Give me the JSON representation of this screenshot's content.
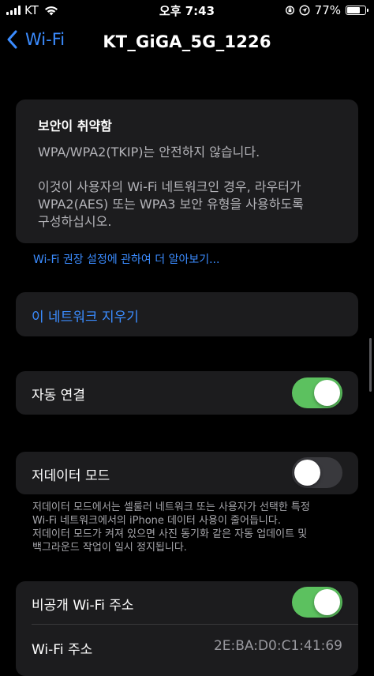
{
  "status_bar": {
    "carrier": "KT",
    "time": "오후 7:43",
    "battery_text": "77%",
    "battery_level": 0.77
  },
  "nav": {
    "back_label": "Wi-Fi",
    "title": "KT_GiGA_5G_1226"
  },
  "warning": {
    "title": "보안이 취약함",
    "line1": "WPA/WPA2(TKIP)는 안전하지 않습니다.",
    "line2": "이것이 사용자의 Wi-Fi 네트워크인 경우, 라우터가",
    "line3": "WPA2(AES) 또는 WPA3 보안 유형을 사용하도록",
    "line4": "구성하십시오."
  },
  "learn_more_link": "Wi-Fi 권장 설정에 관하여 더 알아보기...",
  "forget_network": "이 네트워크 지우기",
  "auto_join": {
    "label": "자동 연결",
    "on": true
  },
  "low_data_mode": {
    "label": "저데이터 모드",
    "on": false,
    "note_line1": "저데이터 모드에서는 셀룰러 네트워크 또는 사용자가 선택한 특정",
    "note_line2": "Wi-Fi 네트워크에서의 iPhone 데이터 사용이 줄어듭니다.",
    "note_line3": "저데이터 모드가 켜져 있으면 사진 동기화 같은 자동 업데이트 및",
    "note_line4": "백그라운드 작업이 일시 정지됩니다."
  },
  "private_address": {
    "label": "비공개 Wi-Fi 주소",
    "on": true,
    "wifi_address_label": "Wi-Fi 주소",
    "wifi_address_value": "2E:BA:D0:C1:41:69"
  },
  "colors": {
    "accent": "#3b8cff",
    "toggle_on": "#5cc15f",
    "toggle_off": "#39393d",
    "card_bg": "#1c1c1e"
  }
}
